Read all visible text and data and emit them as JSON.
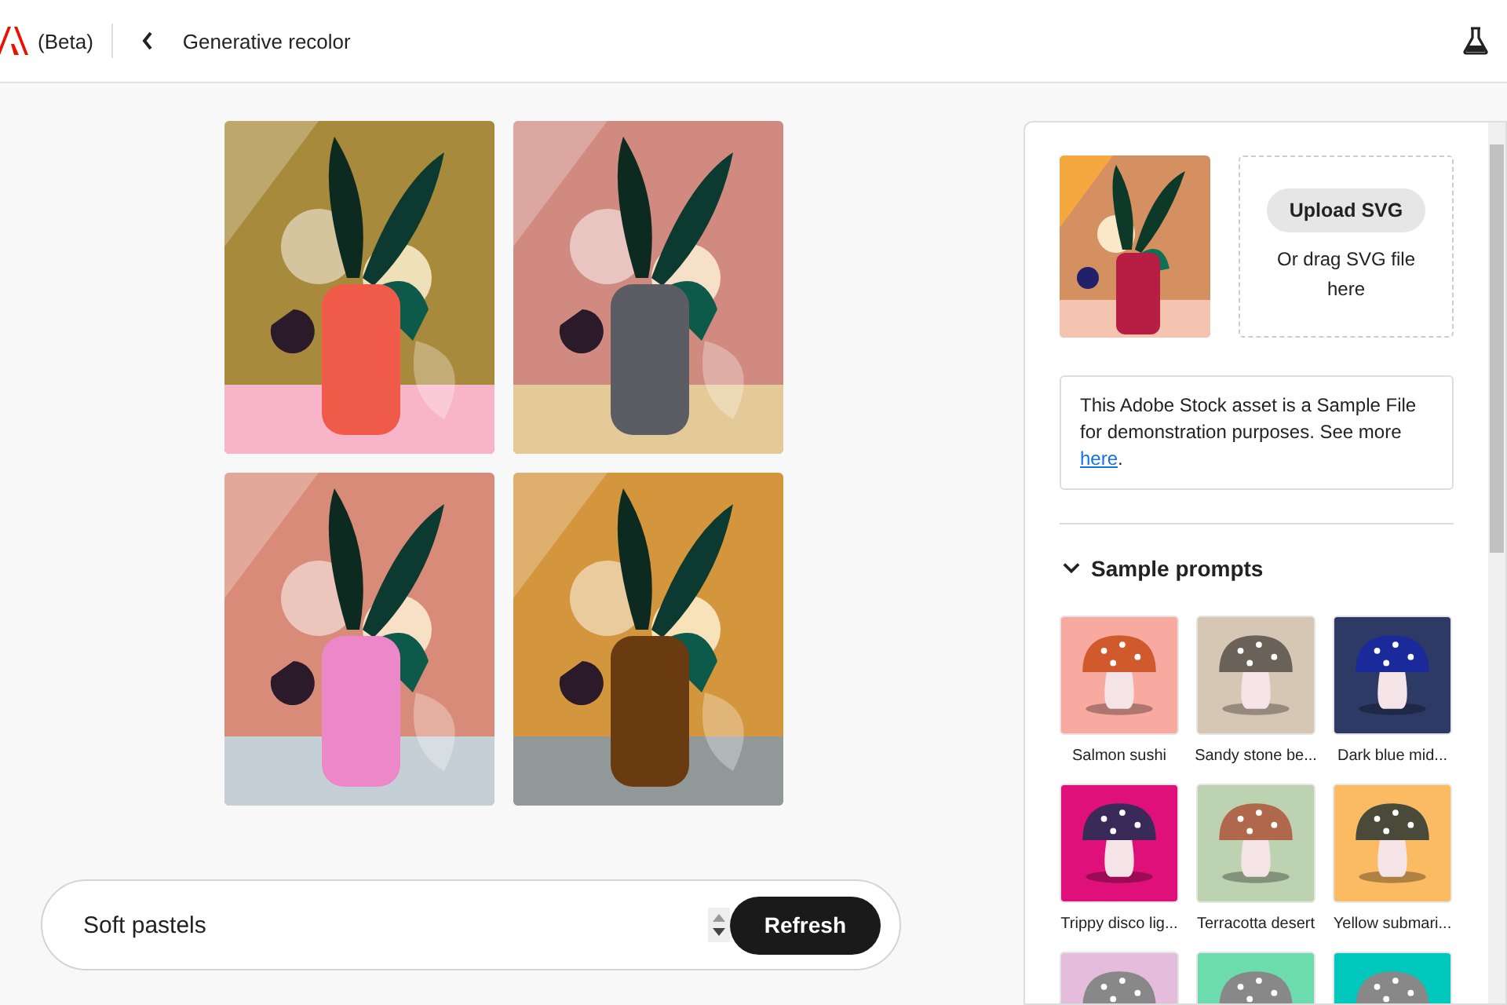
{
  "header": {
    "beta_label": "(Beta)",
    "title": "Generative recolor"
  },
  "results": [
    {
      "color": "#a88a3c"
    },
    {
      "color": "#d08a80"
    },
    {
      "color": "#d88b78"
    },
    {
      "color": "#d4963c"
    }
  ],
  "upload": {
    "button": "Upload SVG",
    "hint": "Or drag SVG file here"
  },
  "notice": {
    "text": "This Adobe Stock asset is a Sample File for demonstration purposes. See more ",
    "link": "here",
    "after": "."
  },
  "sample_prompts": {
    "title": "Sample prompts",
    "expanded": true,
    "items": [
      {
        "label": "Salmon sushi",
        "color": "#f9aaa0"
      },
      {
        "label": "Sandy stone be...",
        "color": "#d6c6b4"
      },
      {
        "label": "Dark blue mid...",
        "color": "#2e3a66"
      },
      {
        "label": "Trippy disco lig...",
        "color": "#e0107a"
      },
      {
        "label": "Terracotta desert",
        "color": "#bcd2b0"
      },
      {
        "label": "Yellow submari...",
        "color": "#fbbb62"
      },
      {
        "color": "#e4bcdc"
      },
      {
        "color": "#6ddcac"
      },
      {
        "color": "#00c8bc"
      }
    ]
  },
  "prompt": {
    "value": "Soft pastels",
    "button": "Refresh"
  }
}
